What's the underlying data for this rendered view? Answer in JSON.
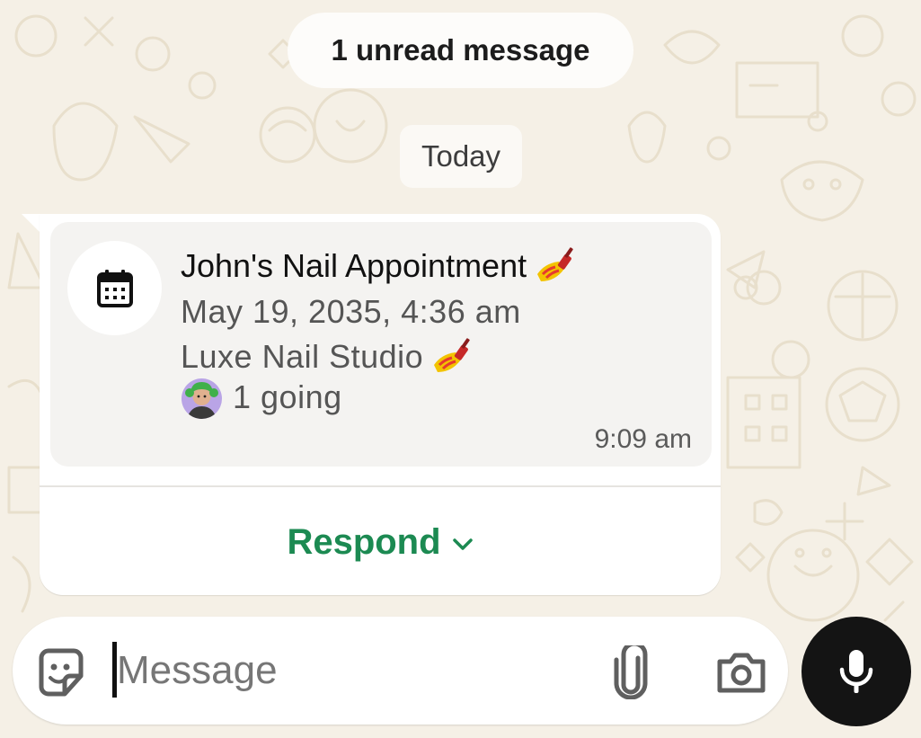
{
  "chat": {
    "unread_banner": "1 unread message",
    "date_chip": "Today"
  },
  "event": {
    "title": "John's Nail Appointment",
    "datetime": "May 19, 2035, 4:36 am",
    "location": "Luxe Nail Studio",
    "going": "1 going",
    "sent_time": "9:09 am",
    "respond_label": "Respond"
  },
  "composer": {
    "placeholder": "Message"
  },
  "icons": {
    "calendar": "calendar-icon",
    "nail_polish_emoji": "nail-polish-emoji",
    "avatar": "avatar-green-hair",
    "respond_chevron": "chevron-down-icon",
    "sticker": "sticker-icon",
    "attach": "paperclip-icon",
    "camera": "camera-icon",
    "mic": "microphone-icon"
  },
  "colors": {
    "wallpaper": "#f5f0e6",
    "accent_green": "#1c8a52",
    "card_bg": "#f4f3f1",
    "mic_button": "#141414"
  }
}
